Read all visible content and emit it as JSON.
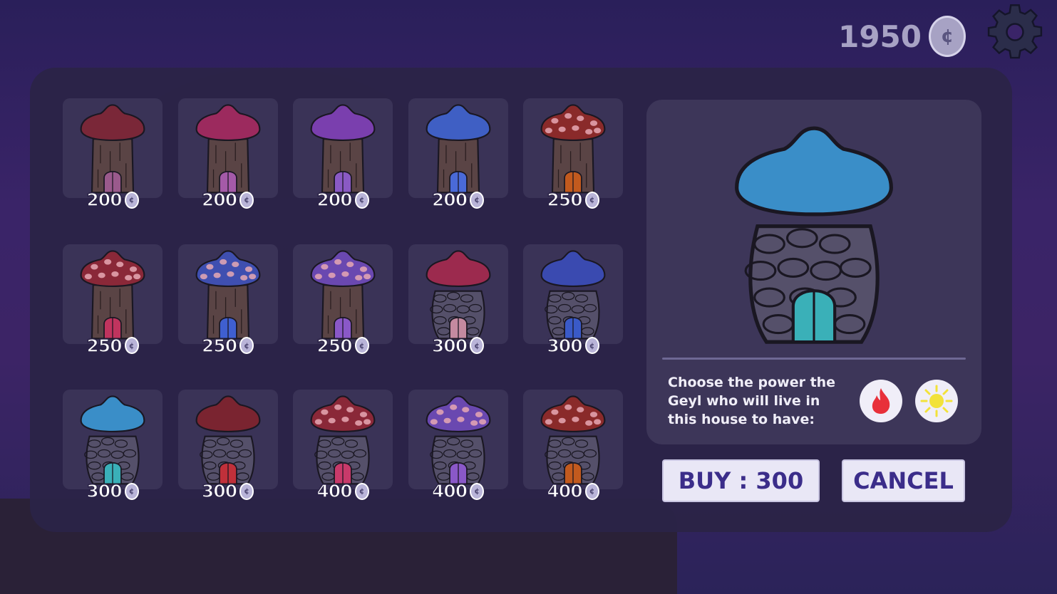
{
  "header": {
    "currency_amount": "1950",
    "coin_symbol": "¢"
  },
  "shop": {
    "items": [
      {
        "price": "200",
        "cap_color": "#7a2738",
        "cap_spots": false,
        "body": "wood",
        "door_color": "#9a5a8c"
      },
      {
        "price": "200",
        "cap_color": "#9c2a5e",
        "cap_spots": false,
        "body": "wood",
        "door_color": "#a45aa8"
      },
      {
        "price": "200",
        "cap_color": "#7a3fae",
        "cap_spots": false,
        "body": "wood",
        "door_color": "#8a5ac4"
      },
      {
        "price": "200",
        "cap_color": "#3f5fc4",
        "cap_spots": false,
        "body": "wood",
        "door_color": "#4a6ad8"
      },
      {
        "price": "250",
        "cap_color": "#8a2a2a",
        "cap_spots": true,
        "body": "wood",
        "door_color": "#c25a1e"
      },
      {
        "price": "250",
        "cap_color": "#8a2838",
        "cap_spots": true,
        "body": "wood",
        "door_color": "#c0345e"
      },
      {
        "price": "250",
        "cap_color": "#3f4fb0",
        "cap_spots": true,
        "body": "wood",
        "door_color": "#3f5fd0"
      },
      {
        "price": "250",
        "cap_color": "#6a48b0",
        "cap_spots": true,
        "body": "wood",
        "door_color": "#8a58c8"
      },
      {
        "price": "300",
        "cap_color": "#9c2a4e",
        "cap_spots": false,
        "body": "stone",
        "door_color": "#c48aa0"
      },
      {
        "price": "300",
        "cap_color": "#3a4ab0",
        "cap_spots": false,
        "body": "stone",
        "door_color": "#3a5ac8"
      },
      {
        "price": "300",
        "cap_color": "#3a8ec8",
        "cap_spots": false,
        "body": "stone",
        "door_color": "#3ab0b8"
      },
      {
        "price": "300",
        "cap_color": "#7a2430",
        "cap_spots": false,
        "body": "stone",
        "door_color": "#c0303a"
      },
      {
        "price": "400",
        "cap_color": "#8a2838",
        "cap_spots": true,
        "body": "stone",
        "door_color": "#c83a6a"
      },
      {
        "price": "400",
        "cap_color": "#6a48b0",
        "cap_spots": true,
        "body": "stone",
        "door_color": "#8a58c8"
      },
      {
        "price": "400",
        "cap_color": "#8a2a2a",
        "cap_spots": true,
        "body": "stone",
        "door_color": "#c25a1e"
      }
    ]
  },
  "preview": {
    "cap_color": "#3a8ec8",
    "door_color": "#3ab0b8",
    "power_prompt": "Choose the power the Geyl who will live in this house to have:",
    "powers": [
      {
        "name": "fire",
        "icon": "fire-icon",
        "color": "#e8303a"
      },
      {
        "name": "light",
        "icon": "sun-icon",
        "color": "#f2e23a"
      }
    ]
  },
  "actions": {
    "buy_label": "BUY : 300",
    "cancel_label": "CANCEL"
  }
}
